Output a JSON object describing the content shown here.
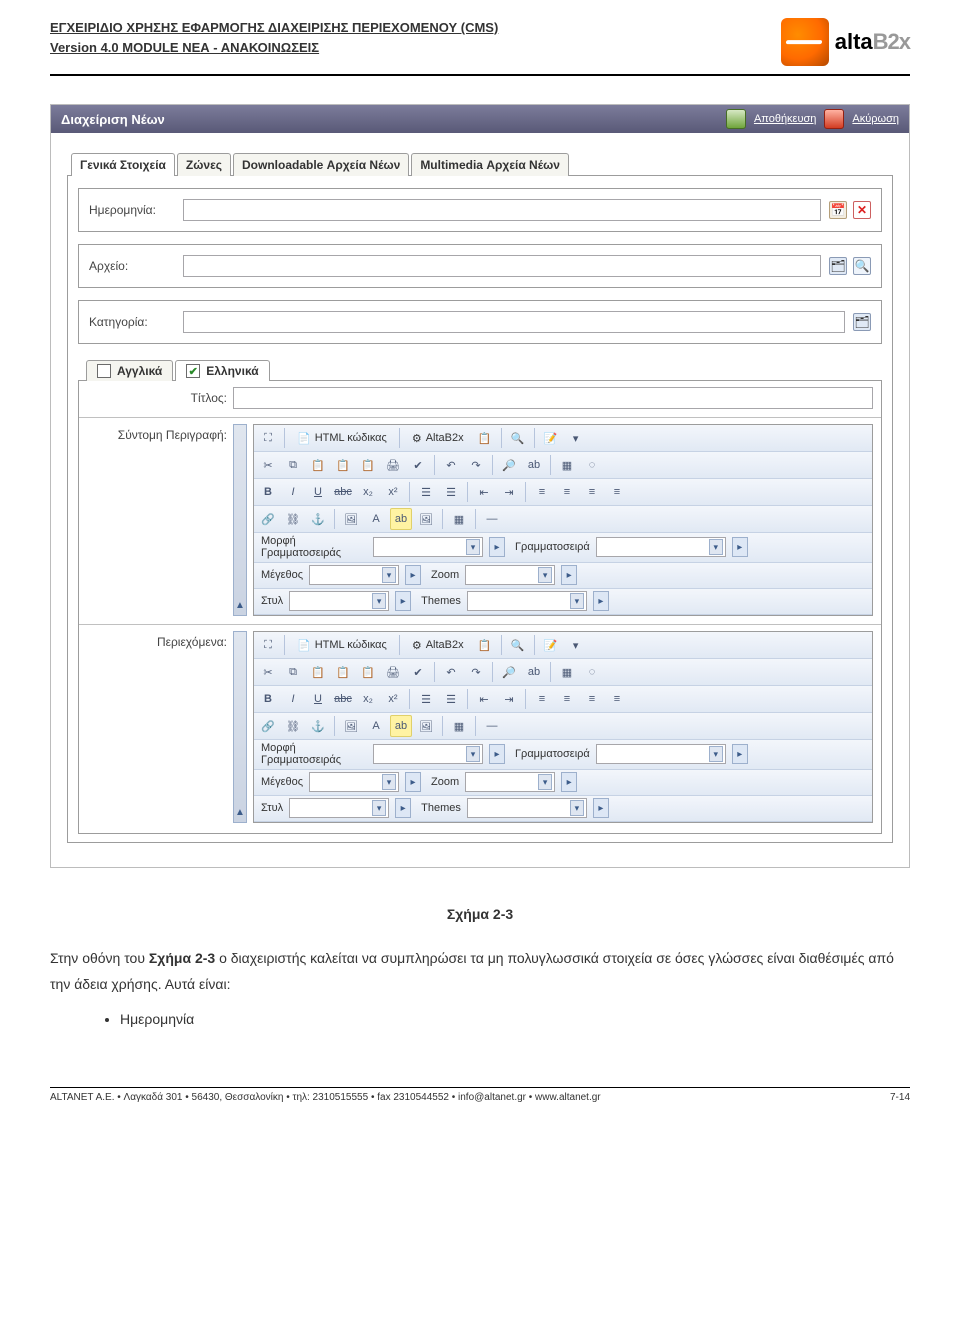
{
  "doc": {
    "title_line1": "ΕΓΧΕΙΡΙΔΙΟ ΧΡΗΣΗΣ ΕΦΑΡΜΟΓΗΣ ΔΙΑΧΕΙΡΙΣΗΣ ΠΕΡΙΕΧΟΜΕΝΟΥ (CMS)",
    "title_line2": "Version 4.0 MODULE ΝΕΑ - ΑΝΑΚΟΙΝΩΣΕΙΣ",
    "logo_text_a": "alta",
    "logo_text_b": "B2x"
  },
  "app": {
    "title": "Διαχείριση Νέων",
    "save_label": "Αποθήκευση",
    "cancel_label": "Ακύρωση"
  },
  "tabs": {
    "t0": "Γενικά Στοιχεία",
    "t1": "Ζώνες",
    "t2": "Downloadable Αρχεία Νέων",
    "t3": "Multimedia Αρχεία Νέων"
  },
  "fields": {
    "date_label": "Ημερομηνία:",
    "file_label": "Αρχείο:",
    "category_label": "Κατηγορία:"
  },
  "lang": {
    "en_label": "Αγγλικά",
    "el_label": "Ελληνικά",
    "title_label": "Τίτλος:",
    "short_desc_label": "Σύντομη Περιγραφή:",
    "content_label": "Περιεχόμενα:"
  },
  "editor": {
    "html_btn": "HTML κώδικας",
    "alta_btn": "AltaB2x",
    "font_format_label": "Μορφή Γραμματοσειράς",
    "font_family_label": "Γραμματοσειρά",
    "size_label": "Μέγεθος",
    "zoom_label": "Zoom",
    "style_label": "Στυλ",
    "themes_label": "Themes"
  },
  "caption": "Σχήμα 2-3",
  "paragraph_pre": "Στην οθόνη του ",
  "paragraph_bold": "Σχήμα 2-3",
  "paragraph_post": " ο διαχειριστής καλείται να συμπληρώσει τα μη πολυγλωσσικά στοιχεία σε όσες γλώσσες είναι διαθέσιμές από την άδεια χρήσης. Αυτά είναι:",
  "bullet1": "Ημερομηνία",
  "footer_left": "ALTANET A.E. • Λαγκαδά 301 • 56430, Θεσσαλονίκη • τηλ: 2310515555 • fax 2310544552 • info@altanet.gr • www.altanet.gr",
  "footer_right": "7-14"
}
